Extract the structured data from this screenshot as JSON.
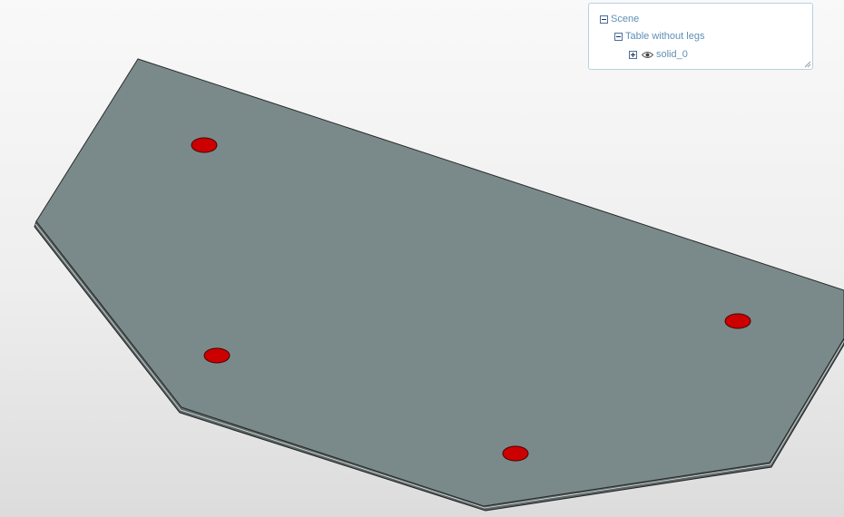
{
  "viewport": {
    "background_top": "#f9f9f9",
    "background_bottom": "#dcdcdc",
    "object": {
      "name": "Table without legs",
      "face_color": "#7a8a8a",
      "edge_color": "#2b2b2b",
      "hole_color": "#cc0000",
      "hole_count": 4
    }
  },
  "scene_tree": {
    "root": {
      "label": "Scene",
      "expanded": true,
      "icon": "minus-box-icon"
    },
    "group": {
      "label": "Table without legs",
      "expanded": true,
      "icon": "minus-box-icon"
    },
    "leaf": {
      "label": "solid_0",
      "expanded": false,
      "icon": "plus-box-icon",
      "visibility_icon": "eye-icon",
      "visible": true
    },
    "link_color": "#5f8fb6"
  }
}
